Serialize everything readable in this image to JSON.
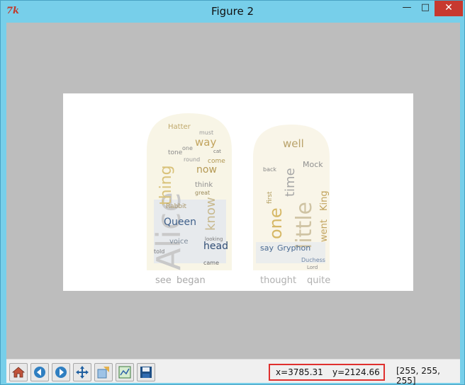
{
  "window": {
    "title": "Figure 2"
  },
  "title_controls": {
    "minimize": "—",
    "maximize": "□",
    "close": "✕"
  },
  "colors": {
    "accent": "#77cfea",
    "highlight": "#e0302e",
    "figure_bg": "#ffffff",
    "canvas_bg": "#bdbdbd"
  },
  "toolbar": {
    "buttons": [
      {
        "name": "home",
        "icon": "home-icon"
      },
      {
        "name": "back",
        "icon": "back-arrow-icon"
      },
      {
        "name": "forward",
        "icon": "forward-arrow-icon"
      },
      {
        "name": "pan",
        "icon": "pan-arrows-icon"
      },
      {
        "name": "zoom",
        "icon": "zoom-rect-icon"
      },
      {
        "name": "configure-subplots",
        "icon": "subplots-icon"
      },
      {
        "name": "save",
        "icon": "floppy-disk-icon"
      }
    ]
  },
  "status": {
    "x": "x=3785.31",
    "y": "y=2124.66",
    "rgb": "[255, 255, 255]"
  },
  "wordcloud_left": {
    "words": [
      "Alice",
      "thing",
      "know",
      "now",
      "Queen",
      "head",
      "way",
      "Hatter",
      "see",
      "began",
      "voice",
      "Rabbit",
      "think",
      "come",
      "round",
      "one",
      "must",
      "came",
      "tone",
      "looking",
      "great",
      "cat",
      "told"
    ]
  },
  "wordcloud_right": {
    "words": [
      "little",
      "one",
      "time",
      "went",
      "King",
      "well",
      "Mock",
      "say",
      "Gryphon",
      "thought",
      "quite",
      "first",
      "back",
      "Duchess",
      "Lord"
    ]
  }
}
